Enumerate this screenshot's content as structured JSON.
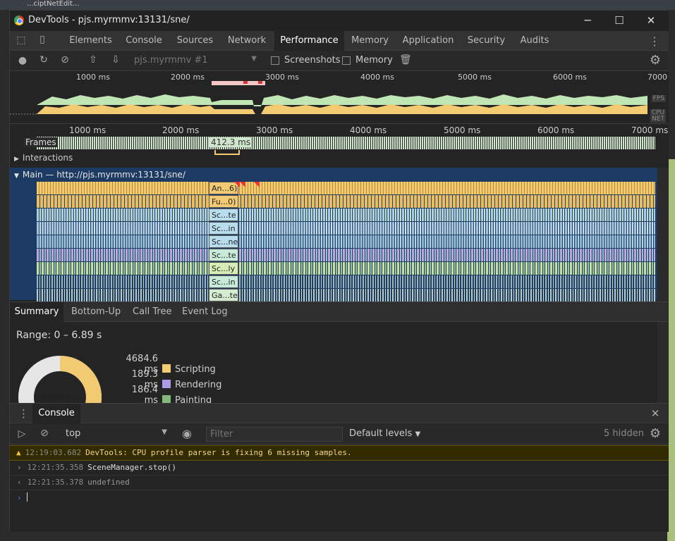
{
  "background": {
    "title_fragment": "...ciptNetEdit..."
  },
  "window": {
    "title": "DevTools - pjs.myrmmv:13131/sne/",
    "minimize": "─",
    "maximize": "☐",
    "close": "✕"
  },
  "tabs": [
    {
      "label": "Elements"
    },
    {
      "label": "Console"
    },
    {
      "label": "Sources"
    },
    {
      "label": "Network"
    },
    {
      "label": "Performance"
    },
    {
      "label": "Memory"
    },
    {
      "label": "Application"
    },
    {
      "label": "Security"
    },
    {
      "label": "Audits"
    }
  ],
  "perf_toolbar": {
    "profile_select": "pjs.myrmmv #1",
    "screenshots_label": "Screenshots",
    "memory_label": "Memory"
  },
  "overview": {
    "ticks": [
      "1000 ms",
      "2000 ms",
      "3000 ms",
      "4000 ms",
      "5000 ms",
      "6000 ms",
      "7000"
    ],
    "fps_label": "FPS",
    "cpu_label": "CPU",
    "net_label": "NET"
  },
  "flamechart": {
    "ticks": [
      "1000 ms",
      "2000 ms",
      "3000 ms",
      "4000 ms",
      "5000 ms",
      "6000 ms",
      "7000 ms"
    ],
    "frames_label": "Frames",
    "frame_time": "412.3 ms",
    "interactions_label": "Interactions",
    "main_label": "Main — http://pjs.myrmmv:13131/sne/",
    "entries": [
      "An...6)",
      "Fu...0)",
      "Sc...te",
      "Sc...in",
      "Sc...ne",
      "Sc...te",
      "Sc...ly",
      "Sc...in",
      "Ga...te"
    ]
  },
  "bottom_tabs": [
    {
      "label": "Summary"
    },
    {
      "label": "Bottom-Up"
    },
    {
      "label": "Call Tree"
    },
    {
      "label": "Event Log"
    }
  ],
  "summary": {
    "range": "Range: 0 – 6.89 s",
    "total": "6893 ms",
    "legend": [
      {
        "value": "4684.6 ms",
        "label": "Scripting",
        "color": "#f2ca71"
      },
      {
        "value": "189.3 ms",
        "label": "Rendering",
        "color": "#af9ae8"
      },
      {
        "value": "186.4 ms",
        "label": "Painting",
        "color": "#84b97a"
      }
    ]
  },
  "console": {
    "tab_label": "Console",
    "context": "top",
    "filter_placeholder": "Filter",
    "levels": "Default levels",
    "hidden": "5 hidden",
    "messages": [
      {
        "time": "12:19:03.682",
        "text": "DevTools: CPU profile parser is fixing 6 missing samples."
      },
      {
        "time": "12:21:35.358",
        "text": "SceneManager.stop()"
      },
      {
        "time": "12:21:35.378",
        "text": "undefined"
      }
    ]
  }
}
